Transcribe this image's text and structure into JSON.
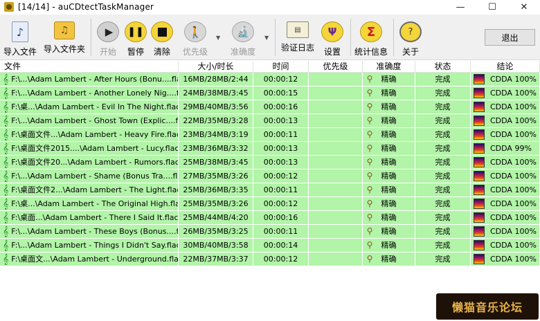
{
  "window": {
    "title": "[14/14] - auCDtectTaskManager",
    "minimize": "—",
    "maximize": "☐",
    "close": "✕"
  },
  "toolbar": {
    "import_file": "导入文件",
    "import_folder": "导入文件夹",
    "start": "开始",
    "pause": "暂停",
    "clear": "清除",
    "priority": "优先级",
    "accuracy": "准确度",
    "verify_log": "验证日志",
    "settings": "设置",
    "stats": "统计信息",
    "about": "关于",
    "exit": "退出"
  },
  "columns": {
    "file": "文件",
    "size": "大小/时长",
    "time": "时间",
    "priority": "优先级",
    "accuracy": "准确度",
    "status": "状态",
    "result": "结论"
  },
  "rows": [
    {
      "file": "F:\\...\\Adam Lambert - After Hours (Bonu....flac",
      "size": "16MB/28MB/2:44",
      "time": "00:00:12",
      "priority": "",
      "accuracy": "精确",
      "status": "完成",
      "result": "CDDA 100%"
    },
    {
      "file": "F:\\...\\Adam Lambert - Another Lonely Nig....flac",
      "size": "24MB/38MB/3:45",
      "time": "00:00:15",
      "priority": "",
      "accuracy": "精确",
      "status": "完成",
      "result": "CDDA 100%"
    },
    {
      "file": "F:\\桌...\\Adam Lambert - Evil In The Night.flac",
      "size": "29MB/40MB/3:56",
      "time": "00:00:16",
      "priority": "",
      "accuracy": "精确",
      "status": "完成",
      "result": "CDDA 100%"
    },
    {
      "file": "F:\\...\\Adam Lambert - Ghost Town (Explic....flac",
      "size": "22MB/35MB/3:28",
      "time": "00:00:13",
      "priority": "",
      "accuracy": "精确",
      "status": "完成",
      "result": "CDDA 100%"
    },
    {
      "file": "F:\\桌面文件...\\Adam Lambert - Heavy Fire.flac",
      "size": "23MB/34MB/3:19",
      "time": "00:00:11",
      "priority": "",
      "accuracy": "精确",
      "status": "完成",
      "result": "CDDA 100%"
    },
    {
      "file": "F:\\桌面文件2015....\\Adam Lambert - Lucy.flac",
      "size": "23MB/36MB/3:32",
      "time": "00:00:13",
      "priority": "",
      "accuracy": "精确",
      "status": "完成",
      "result": "CDDA 99%"
    },
    {
      "file": "F:\\桌面文件20...\\Adam Lambert - Rumors.flac",
      "size": "25MB/38MB/3:45",
      "time": "00:00:13",
      "priority": "",
      "accuracy": "精确",
      "status": "完成",
      "result": "CDDA 100%"
    },
    {
      "file": "F:\\...\\Adam Lambert - Shame (Bonus Tra....flac",
      "size": "27MB/35MB/3:26",
      "time": "00:00:12",
      "priority": "",
      "accuracy": "精确",
      "status": "完成",
      "result": "CDDA 100%"
    },
    {
      "file": "F:\\桌面文件2...\\Adam Lambert - The Light.flac",
      "size": "25MB/36MB/3:35",
      "time": "00:00:11",
      "priority": "",
      "accuracy": "精确",
      "status": "完成",
      "result": "CDDA 100%"
    },
    {
      "file": "F:\\桌...\\Adam Lambert - The Original High.flac",
      "size": "25MB/35MB/3:26",
      "time": "00:00:12",
      "priority": "",
      "accuracy": "精确",
      "status": "完成",
      "result": "CDDA 100%"
    },
    {
      "file": "F:\\桌面...\\Adam Lambert - There I Said It.flac",
      "size": "25MB/44MB/4:20",
      "time": "00:00:16",
      "priority": "",
      "accuracy": "精确",
      "status": "完成",
      "result": "CDDA 100%"
    },
    {
      "file": "F:\\...\\Adam Lambert - These Boys (Bonus....flac",
      "size": "26MB/35MB/3:25",
      "time": "00:00:11",
      "priority": "",
      "accuracy": "精确",
      "status": "完成",
      "result": "CDDA 100%"
    },
    {
      "file": "F:\\...\\Adam Lambert - Things I Didn't Say.flac",
      "size": "30MB/40MB/3:58",
      "time": "00:00:14",
      "priority": "",
      "accuracy": "精确",
      "status": "完成",
      "result": "CDDA 100%"
    },
    {
      "file": "F:\\桌面文...\\Adam Lambert - Underground.flac",
      "size": "22MB/37MB/3:37",
      "time": "00:00:12",
      "priority": "",
      "accuracy": "精确",
      "status": "完成",
      "result": "CDDA 100%"
    }
  ],
  "watermark": "懒猫音乐论坛",
  "colors": {
    "row_complete": "#b2f4a8"
  }
}
